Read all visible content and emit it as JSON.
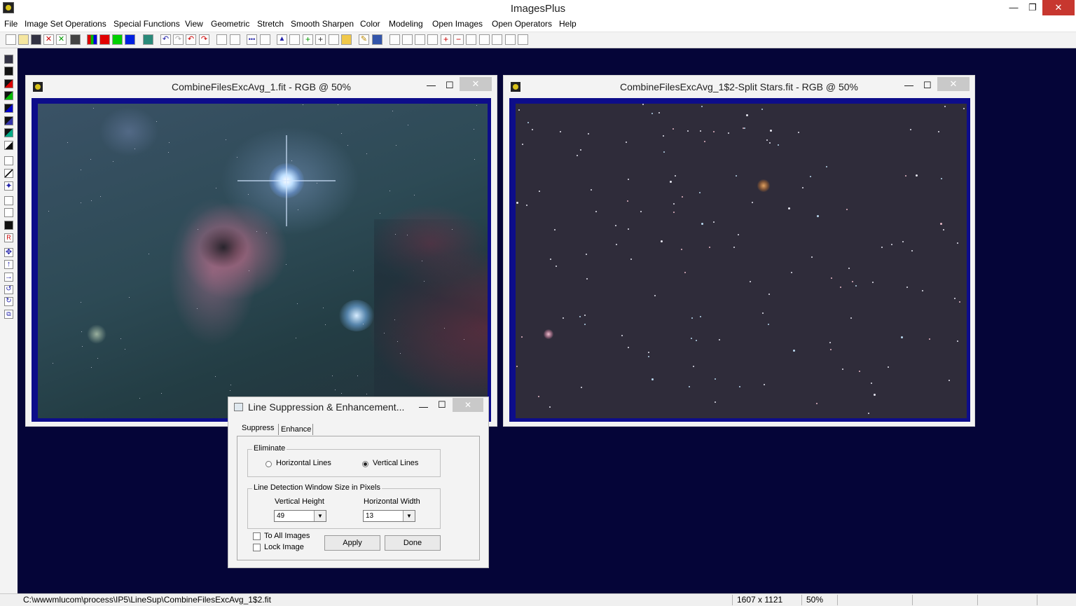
{
  "app": {
    "title": "ImagesPlus",
    "minimize": "—",
    "restore": "❐",
    "close": "✕"
  },
  "menu": [
    "File",
    "Image Set Operations",
    "Special Functions",
    "View",
    "Geometric",
    "Stretch",
    "Smooth Sharpen",
    "Color",
    "Modeling",
    "Open Images",
    "Open Operators",
    "Help"
  ],
  "windows": {
    "left": {
      "title": "CombineFilesExcAvg_1.fit - RGB @ 50%",
      "min": "—",
      "max": "☐",
      "close": "✕"
    },
    "right": {
      "title": "CombineFilesExcAvg_1$2-Split Stars.fit - RGB @ 50%",
      "min": "—",
      "max": "☐",
      "close": "✕"
    }
  },
  "dialog": {
    "title": "Line Suppression & Enhancement...",
    "min": "—",
    "max": "☐",
    "close": "✕",
    "tabs": [
      "Suppress",
      "Enhance"
    ],
    "eliminate": {
      "label": "Eliminate",
      "horizontal": "Horizontal Lines",
      "vertical": "Vertical Lines",
      "selected": "Vertical Lines"
    },
    "window_size": {
      "label": "Line Detection Window Size in Pixels",
      "vertical_label": "Vertical Height",
      "vertical_value": "49",
      "horizontal_label": "Horizontal Width",
      "horizontal_value": "13"
    },
    "to_all_images": "To All Images",
    "lock_image": "Lock Image",
    "apply": "Apply",
    "done": "Done"
  },
  "status": {
    "path": "C:\\wwwmlucom\\process\\IP5\\LineSup\\CombineFilesExcAvg_1$2.fit",
    "dimensions": "1607 x 1121",
    "zoom": "50%"
  }
}
